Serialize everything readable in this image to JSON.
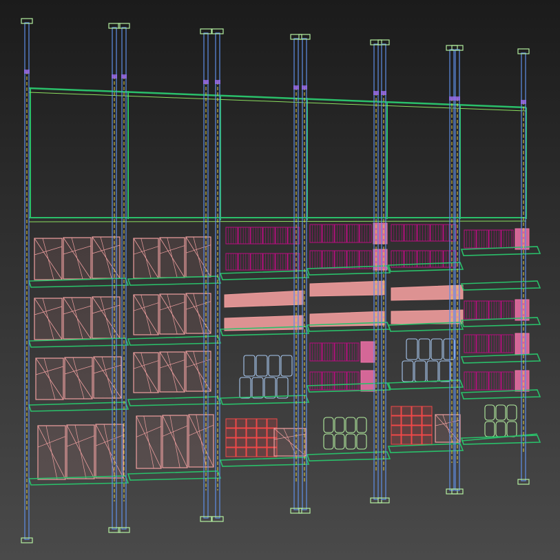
{
  "viewport": {
    "background_top": "#1b1b1b",
    "background_bottom": "#4a4a4a",
    "render_mode": "wireframe"
  },
  "colors": {
    "post": "#5f8fe8",
    "post_inner": "#e6d24a",
    "post_cap": "#b4f0a0",
    "post_joint": "#9b6cf0",
    "frame": "#2ac06a",
    "frame_light": "#8ce060",
    "box_salmon": "#f0a0a0",
    "basket_magenta": "#b0107a",
    "basket_pink": "#f070a8",
    "wedge_salmon": "#f09c9c",
    "can_blue": "#a8c8f0",
    "crate_red": "#f04848",
    "jar_green": "#b4f0a0"
  },
  "scene": {
    "object_name": "shelving-unit-wireframe",
    "bays": 6,
    "shelf_levels": 4,
    "upright_posts": 12
  }
}
